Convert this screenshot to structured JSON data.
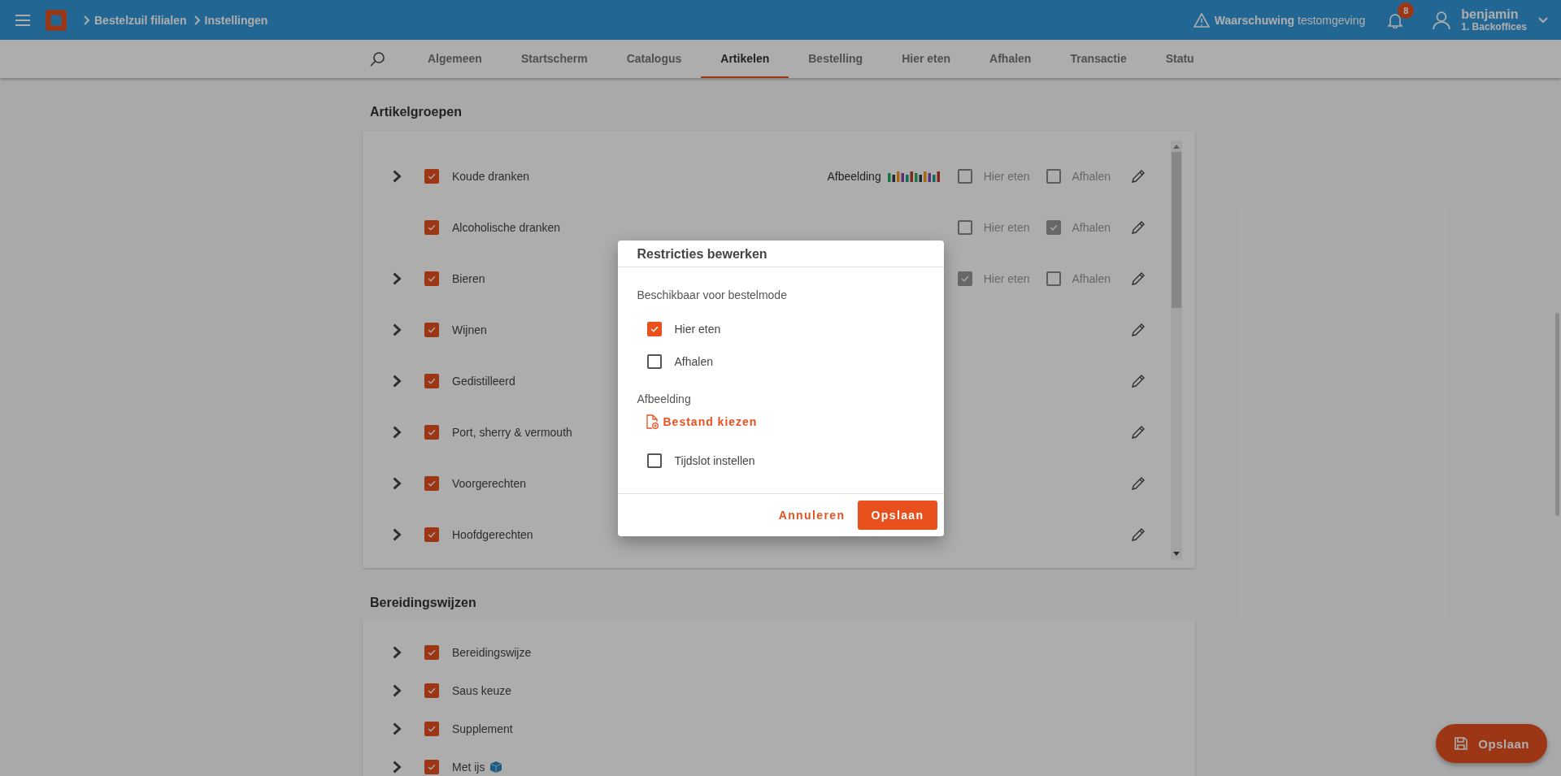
{
  "header": {
    "breadcrumbs": [
      "Bestelzuil filialen",
      "Instellingen"
    ],
    "warning": {
      "label": "Waarschuwing",
      "text": "testomgeving"
    },
    "notifications": {
      "count": "8"
    },
    "user": {
      "name": "benjamin",
      "role": "1. Backoffices"
    }
  },
  "tabs": [
    {
      "label": "Algemeen",
      "selected": false
    },
    {
      "label": "Startscherm",
      "selected": false
    },
    {
      "label": "Catalogus",
      "selected": false
    },
    {
      "label": "Artikelen",
      "selected": true
    },
    {
      "label": "Bestelling",
      "selected": false
    },
    {
      "label": "Hier eten",
      "selected": false
    },
    {
      "label": "Afhalen",
      "selected": false
    },
    {
      "label": "Transactie",
      "selected": false
    },
    {
      "label": "Statu",
      "selected": false
    }
  ],
  "article_groups": {
    "title": "Artikelgroepen",
    "rows": [
      {
        "label": "Koude dranken",
        "expandable": true,
        "checked": true,
        "image_label": "Afbeelding",
        "modes": [
          {
            "label": "Hier eten",
            "checked": false
          },
          {
            "label": "Afhalen",
            "checked": false
          }
        ]
      },
      {
        "label": "Alcoholische dranken",
        "expandable": false,
        "checked": true,
        "modes": [
          {
            "label": "Hier eten",
            "checked": false
          },
          {
            "label": "Afhalen",
            "checked": true
          }
        ]
      },
      {
        "label": "Bieren",
        "expandable": true,
        "checked": true,
        "modes": [
          {
            "label": "Hier eten",
            "checked": true
          },
          {
            "label": "Afhalen",
            "checked": false
          }
        ]
      },
      {
        "label": "Wijnen",
        "expandable": true,
        "checked": true
      },
      {
        "label": "Gedistilleerd",
        "expandable": true,
        "checked": true
      },
      {
        "label": "Port, sherry & vermouth",
        "expandable": true,
        "checked": true
      },
      {
        "label": "Voorgerechten",
        "expandable": true,
        "checked": true
      },
      {
        "label": "Hoofdgerechten",
        "expandable": true,
        "checked": true
      }
    ]
  },
  "preparations": {
    "title": "Bereidingswijzen",
    "rows": [
      {
        "label": "Bereidingswijze",
        "checked": true,
        "ice_icon": false
      },
      {
        "label": "Saus keuze",
        "checked": true,
        "ice_icon": false
      },
      {
        "label": "Supplement",
        "checked": true,
        "ice_icon": false
      },
      {
        "label": "Met ijs",
        "checked": true,
        "ice_icon": true
      }
    ]
  },
  "dialog": {
    "title": "Restricties bewerken",
    "modes_label": "Beschikbaar voor bestelmode",
    "modes": [
      {
        "label": "Hier eten",
        "checked": true
      },
      {
        "label": "Afhalen",
        "checked": false
      }
    ],
    "image_label": "Afbeelding",
    "file_button": "Bestand kiezen",
    "timeslot": {
      "label": "Tijdslot instellen",
      "checked": false
    },
    "cancel": "Annuleren",
    "save": "Opslaan"
  },
  "fab": {
    "label": "Opslaan"
  }
}
